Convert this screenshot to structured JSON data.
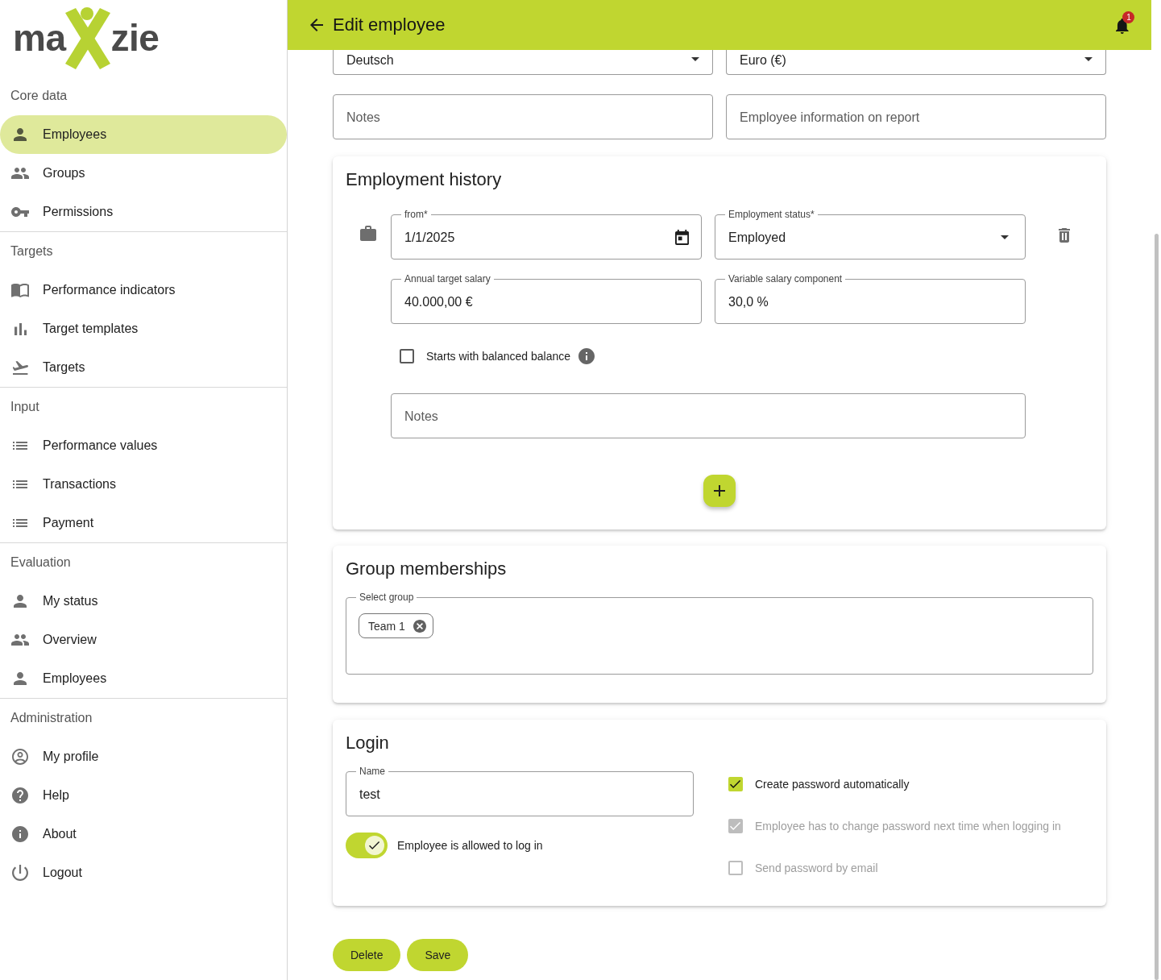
{
  "logo": {
    "text_left": "ma",
    "text_right": "zie"
  },
  "sidebar": {
    "sections": [
      {
        "title": "Core data",
        "items": [
          {
            "label": "Employees",
            "selected": true
          },
          {
            "label": "Groups",
            "selected": false
          },
          {
            "label": "Permissions",
            "selected": false
          }
        ]
      },
      {
        "title": "Targets",
        "items": [
          {
            "label": "Performance indicators",
            "selected": false
          },
          {
            "label": "Target templates",
            "selected": false
          },
          {
            "label": "Targets",
            "selected": false
          }
        ]
      },
      {
        "title": "Input",
        "items": [
          {
            "label": "Performance values",
            "selected": false
          },
          {
            "label": "Transactions",
            "selected": false
          },
          {
            "label": "Payment",
            "selected": false
          }
        ]
      },
      {
        "title": "Evaluation",
        "items": [
          {
            "label": "My status",
            "selected": false
          },
          {
            "label": "Overview",
            "selected": false
          },
          {
            "label": "Employees",
            "selected": false
          }
        ]
      },
      {
        "title": "Administration",
        "items": [
          {
            "label": "My profile",
            "selected": false
          },
          {
            "label": "Help",
            "selected": false
          },
          {
            "label": "About",
            "selected": false
          },
          {
            "label": "Logout",
            "selected": false
          }
        ]
      }
    ]
  },
  "topbar": {
    "title": "Edit employee",
    "notification_badge": "1"
  },
  "form": {
    "selects": [
      {
        "value": "Deutsch"
      },
      {
        "value": "Euro (€)"
      }
    ],
    "text_fields": [
      {
        "placeholder": "Notes"
      },
      {
        "placeholder": "Employee information on report"
      }
    ]
  },
  "employment_history": {
    "title": "Employment history",
    "entries": [
      {
        "from": {
          "label": "from*",
          "value": "1/1/2025"
        },
        "status": {
          "label": "Employment status*",
          "value": "Employed"
        },
        "salary": {
          "label": "Annual target salary",
          "value": "40.000,00 €"
        },
        "variable": {
          "label": "Variable salary component",
          "value": "30,0 %"
        },
        "balanced": {
          "label": "Starts with balanced balance",
          "checked": false
        },
        "notes": {
          "placeholder": "Notes"
        }
      }
    ]
  },
  "group_memberships": {
    "title": "Group memberships",
    "field_label": "Select group",
    "chips": [
      {
        "label": "Team 1"
      }
    ]
  },
  "login": {
    "title": "Login",
    "name": {
      "label": "Name",
      "value": "test"
    },
    "allowed": {
      "label": "Employee is allowed to log in",
      "on": true
    },
    "options": [
      {
        "label": "Create password automatically",
        "checked": true,
        "disabled": false
      },
      {
        "label": "Employee has to change password next time when logging in",
        "checked": true,
        "disabled": true
      },
      {
        "label": "Send password by email",
        "checked": false,
        "disabled": true
      }
    ]
  },
  "buttons": [
    {
      "label": "Delete"
    },
    {
      "label": "Save"
    }
  ]
}
